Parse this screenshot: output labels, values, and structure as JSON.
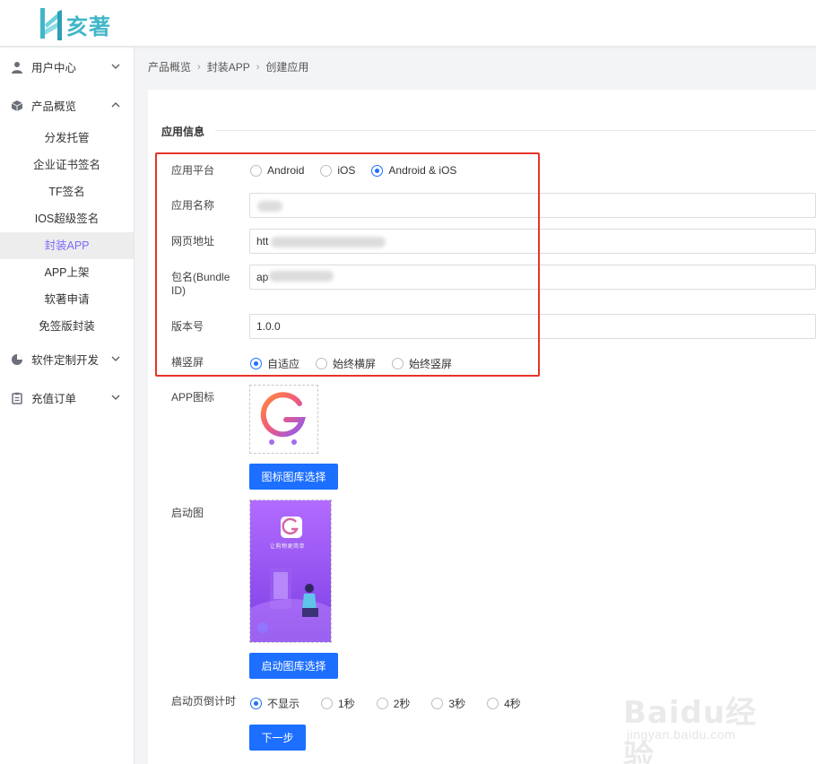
{
  "brand": {
    "logo_text": "亥著"
  },
  "sidebar": {
    "groups": [
      {
        "label": "用户中心",
        "icon": "user-icon",
        "expanded": false
      },
      {
        "label": "产品概览",
        "icon": "cube-icon",
        "expanded": true
      },
      {
        "label": "软件定制开发",
        "icon": "pie-chart-icon",
        "expanded": false
      },
      {
        "label": "充值订单",
        "icon": "clipboard-icon",
        "expanded": false
      }
    ],
    "sub_items": [
      "分发托管",
      "企业证书签名",
      "TF签名",
      "IOS超级签名",
      "封装APP",
      "APP上架",
      "软著申请",
      "免签版封装"
    ],
    "active_sub": "封装APP"
  },
  "breadcrumb": [
    "产品概览",
    "封装APP",
    "创建应用"
  ],
  "form": {
    "section_title": "应用信息",
    "platform": {
      "label": "应用平台",
      "options": [
        "Android",
        "iOS",
        "Android & iOS"
      ],
      "selected": "Android & iOS"
    },
    "app_name": {
      "label": "应用名称",
      "value": ""
    },
    "web_url": {
      "label": "网页地址",
      "value": "htt"
    },
    "bundle_id": {
      "label": "包名(Bundle ID)",
      "value": "ap"
    },
    "version": {
      "label": "版本号",
      "value": "1.0.0"
    },
    "orientation": {
      "label": "横竖屏",
      "options": [
        "自适应",
        "始终横屏",
        "始终竖屏"
      ],
      "selected": "自适应"
    },
    "app_icon": {
      "label": "APP图标",
      "button": "图标图库选择"
    },
    "splash": {
      "label": "启动图",
      "button": "启动图库选择",
      "caption": "让购物更简单"
    },
    "countdown": {
      "label": "启动页倒计时",
      "options": [
        "不显示",
        "1秒",
        "2秒",
        "3秒",
        "4秒"
      ],
      "selected": "不显示"
    },
    "next_button": "下一步"
  },
  "watermark": {
    "main": "Baidu经验",
    "sub": "jingyan.baidu.com"
  },
  "colors": {
    "primary": "#1c6fff",
    "active_menu": "#7b6cf6",
    "highlight": "#e8342a",
    "logo": "#41b6c9"
  }
}
